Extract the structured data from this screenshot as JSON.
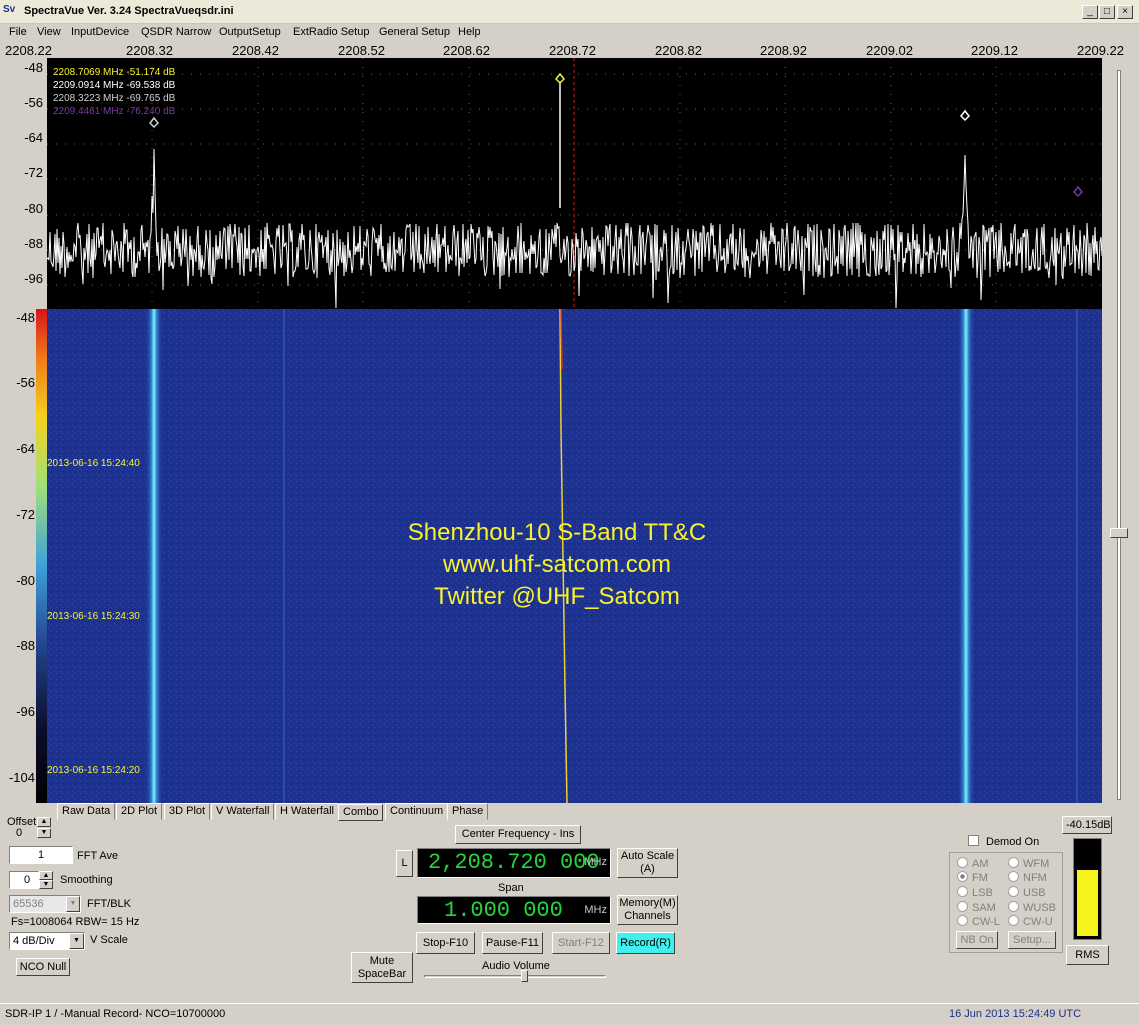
{
  "window": {
    "title": "SpectraVue Ver. 3.24  SpectraVueqsdr.ini",
    "icon": "Sv",
    "minimize_glyph": "_",
    "maximize_glyph": "□",
    "close_glyph": "×"
  },
  "menu": [
    "File",
    "View",
    "InputDevice",
    "QSDR Narrow",
    "OutputSetup",
    "ExtRadio Setup",
    "General Setup",
    "Help"
  ],
  "freq_axis": [
    "2208.22",
    "2208.32",
    "2208.42",
    "2208.52",
    "2208.62",
    "2208.72",
    "2208.82",
    "2208.92",
    "2209.02",
    "2209.12",
    "2209.22"
  ],
  "spectrum_db_axis": [
    "-48",
    "-56",
    "-64",
    "-72",
    "-80",
    "-88",
    "-96"
  ],
  "waterfall_db_axis": [
    "-48",
    "-56",
    "-64",
    "-72",
    "-80",
    "-88",
    "-96",
    "-104"
  ],
  "markers": [
    {
      "text": "2208.7069 MHz  -51.174 dB",
      "color": "#f8f22c"
    },
    {
      "text": "2209.0914 MHz  -69.538 dB",
      "color": "#ffffff"
    },
    {
      "text": "2208.3223 MHz  -69.765 dB",
      "color": "#d0d0d0"
    },
    {
      "text": "2209.4461 MHz  -76.240 dB",
      "color": "#7a3aa0"
    }
  ],
  "timestamps": [
    "2013-06-16 15:24:40",
    "2013-06-16 15:24:30",
    "2013-06-16 15:24:20"
  ],
  "overlay": {
    "line1": "Shenzhou-10 S-Band TT&C",
    "line2": "www.uhf-satcom.com",
    "line3": "Twitter @UHF_Satcom"
  },
  "tabs": [
    "Raw Data",
    "2D Plot",
    "3D Plot",
    "V Waterfall",
    "H Waterfall",
    "Combo",
    "Continuum",
    "Phase"
  ],
  "active_tab": "Combo",
  "left_panel": {
    "offset_label": "Offset",
    "offset_value": "0",
    "fft_ave_value": "1",
    "fft_ave_label": "FFT Ave",
    "smoothing_value": "0",
    "smoothing_label": "Smoothing",
    "fft_blk_value": "65536",
    "fft_blk_label": "FFT/BLK",
    "fs_rbw": "Fs=1008064 RBW=  15 Hz",
    "vscale_value": "4 dB/Div",
    "vscale_label": "V Scale",
    "nco_null": "NCO Null"
  },
  "center": {
    "center_freq_button": "Center Frequency - Ins",
    "l_button": "L",
    "center_freq": "2,208.720 000",
    "center_unit": "MHz",
    "auto_scale": "Auto Scale\n(A)",
    "span_label": "Span",
    "span": "1.000 000",
    "span_unit": "MHz",
    "memory": "Memory(M)\nChannels",
    "stop": "Stop-F10",
    "pause": "Pause-F11",
    "start": "Start-F12",
    "record": "Record(R)",
    "mute": "Mute\nSpaceBar",
    "audio_volume": "Audio Volume"
  },
  "demod": {
    "level": "-40.15dB",
    "demod_on": "Demod On",
    "modes_left": [
      "AM",
      "FM",
      "LSB",
      "SAM",
      "CW-L"
    ],
    "modes_right": [
      "WFM",
      "NFM",
      "USB",
      "WUSB",
      "CW-U"
    ],
    "selected": "FM",
    "nb_on": "NB On",
    "setup": "Setup...",
    "rms": "RMS",
    "meter_level_fraction": 0.7
  },
  "status": {
    "left": "SDR-IP 1  / -Manual Record-    NCO=10700000",
    "datetime": "16 Jun 2013  15:24:49 UTC"
  },
  "colors": {
    "trace": "#ffffff",
    "waterfall_bg": "#1d318e",
    "signal": "#3fe0f0",
    "text_yellow": "#f8f22c",
    "digits_green": "#22d63a"
  }
}
